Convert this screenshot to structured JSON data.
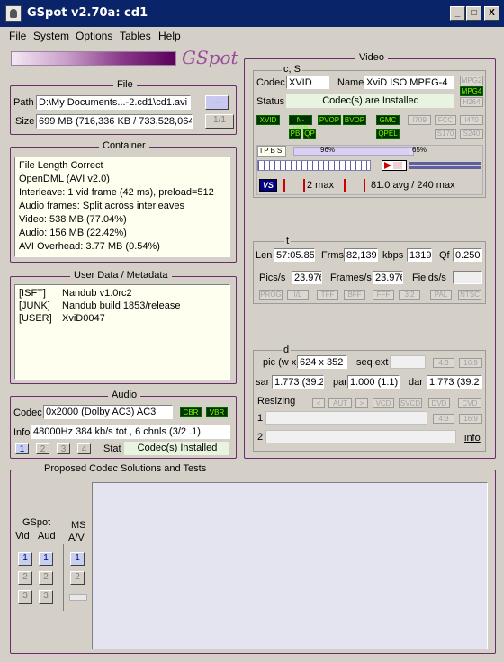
{
  "window": {
    "title": "GSpot v2.70a: cd1",
    "min": "_",
    "max": "□",
    "close": "X"
  },
  "menu": [
    "File",
    "System",
    "Options",
    "Tables",
    "Help"
  ],
  "logo": "GSpot",
  "file": {
    "group_label": "File",
    "path_label": "Path",
    "path_value": "D:\\My Documents...-2.cd1\\cd1.avi",
    "browse_label": "...",
    "size_label": "Size",
    "size_value": "699 MB (716,336 KB / 733,528,064",
    "ratio": "1/1"
  },
  "container": {
    "group_label": "Container",
    "lines": "File Length Correct\nOpenDML (AVI v2.0)\nInterleave: 1 vid frame (42 ms), preload=512\nAudio frames: Split across interleaves\nVideo: 538 MB (77.04%)\nAudio: 156 MB (22.42%)\nAVI Overhead: 3.77 MB (0.54%)"
  },
  "userdata": {
    "group_label": "User Data / Metadata",
    "tags": "[ISFT]\n[JUNK]\n[USER]",
    "values": "Nandub v1.0rc2\nNandub build 1853/release\nXviD0047"
  },
  "audio": {
    "group_label": "Audio",
    "codec_label": "Codec",
    "codec_value": "0x2000 (Dolby AC3) AC3",
    "cbr": "CBR",
    "vbr": "VBR",
    "info_label": "Info",
    "info_value": "48000Hz  384 kb/s tot , 6 chnls (3/2 .1)",
    "tracks": [
      "1",
      "2",
      "3",
      "4"
    ],
    "stat_label": "Stat",
    "stat_value": "Codec(s) Installed"
  },
  "video": {
    "group_label": "Video",
    "cs_label": "c, S",
    "codec_label": "Codec",
    "codec_value": "XVID",
    "name_label": "Name",
    "name_value": "XviD ISO MPEG-4",
    "status_label": "Status",
    "status_value": "Codec(s) are Installed",
    "mpeg_chips": [
      "MPG2",
      "MPG4",
      "H264"
    ],
    "flags_row1": [
      "XVID",
      "N-VOP",
      "PVOP",
      "BVOP",
      "GMC",
      "I709",
      "FCC",
      "I470"
    ],
    "flags_row2": [
      "PB",
      "QP",
      "QPEL",
      "S170",
      "S240"
    ],
    "frame_types": "IPBS",
    "pct1": "96%",
    "pct2": "65%",
    "b_max": "2 max",
    "avg_text": "81.0 avg / 240 max"
  },
  "timing": {
    "label": "t",
    "len_label": "Len",
    "len_value": "57:05.85",
    "frms_label": "Frms",
    "frms_value": "82,139",
    "kbps_label": "kbps",
    "kbps_value": "1319",
    "qf_label": "Qf",
    "qf_value": "0.250",
    "pics_label": "Pics/s",
    "pics_value": "23.976",
    "frames_label": "Frames/s",
    "frames_value": "23.976",
    "fields_label": "Fields/s",
    "fields_value": "",
    "chips": [
      "PROG",
      "I/L",
      "TFF",
      "BFF",
      "FFF",
      "3:2",
      "PAL",
      "NTSC"
    ]
  },
  "dims": {
    "label": "d",
    "pic_label": "pic (w x",
    "pic_value": "624 x 352",
    "seq_label": "seq ext",
    "ar_chips": [
      "4:3",
      "16:9"
    ],
    "sar_label": "sar",
    "sar_value": "1.773 (39:2",
    "par_label": "par",
    "par_value": "1.000 (1:1)",
    "dar_label": "dar",
    "dar_value": "1.773 (39:2",
    "resizing_label": "Resizing",
    "resize_chips": [
      "<",
      "AUT",
      ">",
      "VCD",
      "SVCD",
      "DVD",
      "CVD"
    ],
    "row1": "1",
    "row2": "2",
    "ar2_chips": [
      "4:3",
      "16:9"
    ],
    "info_link": "info"
  },
  "proposed": {
    "group_label": "Proposed Codec Solutions and Tests",
    "gspot_label": "GSpot",
    "vid_label": "Vid",
    "aud_label": "Aud",
    "ms_label": "MS",
    "av_label": "A/V",
    "buttons": [
      "1",
      "2",
      "3"
    ]
  }
}
